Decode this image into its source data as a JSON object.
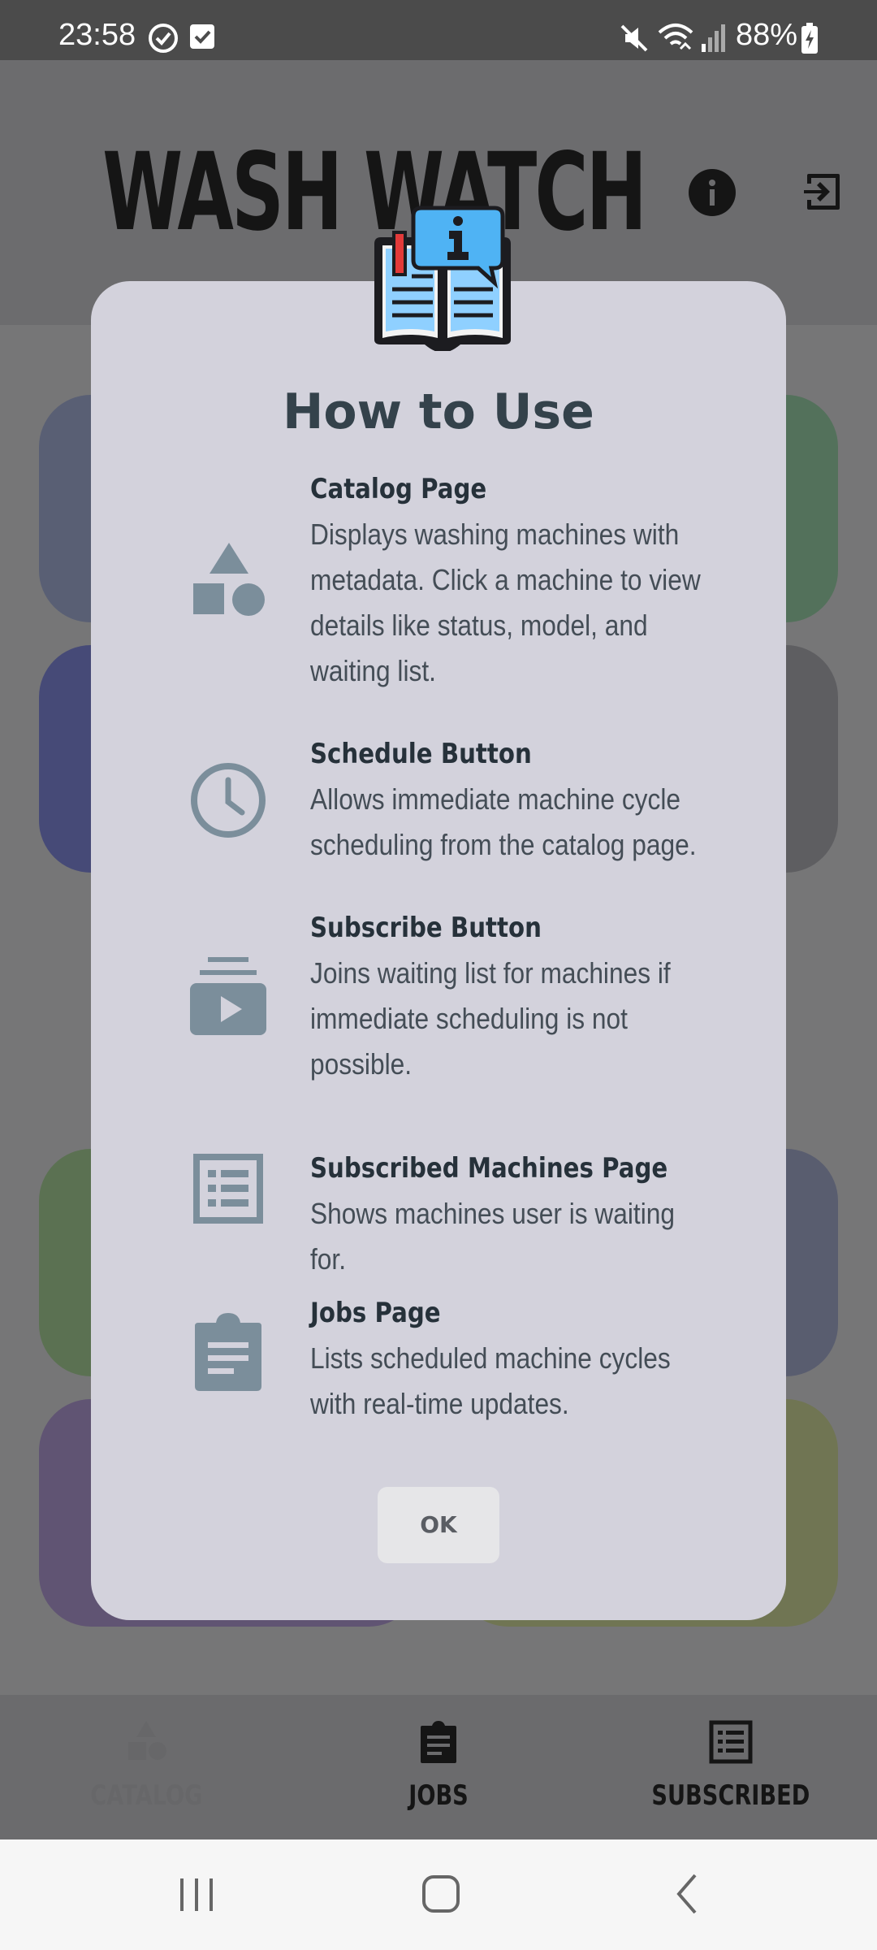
{
  "status_bar": {
    "time": "23:58",
    "battery": "88%",
    "icons": [
      "sync-icon",
      "checkbox-icon",
      "mute-icon",
      "wifi-icon",
      "signal-icon",
      "battery-charging-icon"
    ]
  },
  "header": {
    "title": "WASH WATCH",
    "actions": [
      "info-icon",
      "logout-icon"
    ]
  },
  "bottom_nav": {
    "items": [
      {
        "label": "CATALOG",
        "icon": "shapes-icon",
        "active": true
      },
      {
        "label": "JOBS",
        "icon": "clipboard-icon",
        "active": false
      },
      {
        "label": "SUBSCRIBED",
        "icon": "list-icon",
        "active": false
      }
    ]
  },
  "dialog": {
    "badge_icon": "info-book-icon",
    "title": "How to Use",
    "items": [
      {
        "icon": "shapes-icon",
        "title": "Catalog Page",
        "description": "Displays washing machines with metadata. Click a machine to view details like status, model, and waiting list."
      },
      {
        "icon": "clock-icon",
        "title": "Schedule Button",
        "description": "Allows immediate machine cycle scheduling from the catalog page."
      },
      {
        "icon": "subscriptions-icon",
        "title": "Subscribe Button",
        "description": "Joins waiting list for machines if immediate scheduling is not possible."
      },
      {
        "icon": "list-icon",
        "title": "Subscribed Machines Page",
        "description": "Shows machines user is waiting for."
      },
      {
        "icon": "clipboard-icon",
        "title": "Jobs Page",
        "description": "Lists scheduled machine cycles with real-time updates."
      }
    ],
    "ok_label": "OK"
  },
  "colors": {
    "dialog_bg": "#d3d2dc",
    "icon_gray": "#7b8e9b",
    "title_text": "#34424b",
    "scrim": "rgba(0,0,0,0.5)"
  }
}
